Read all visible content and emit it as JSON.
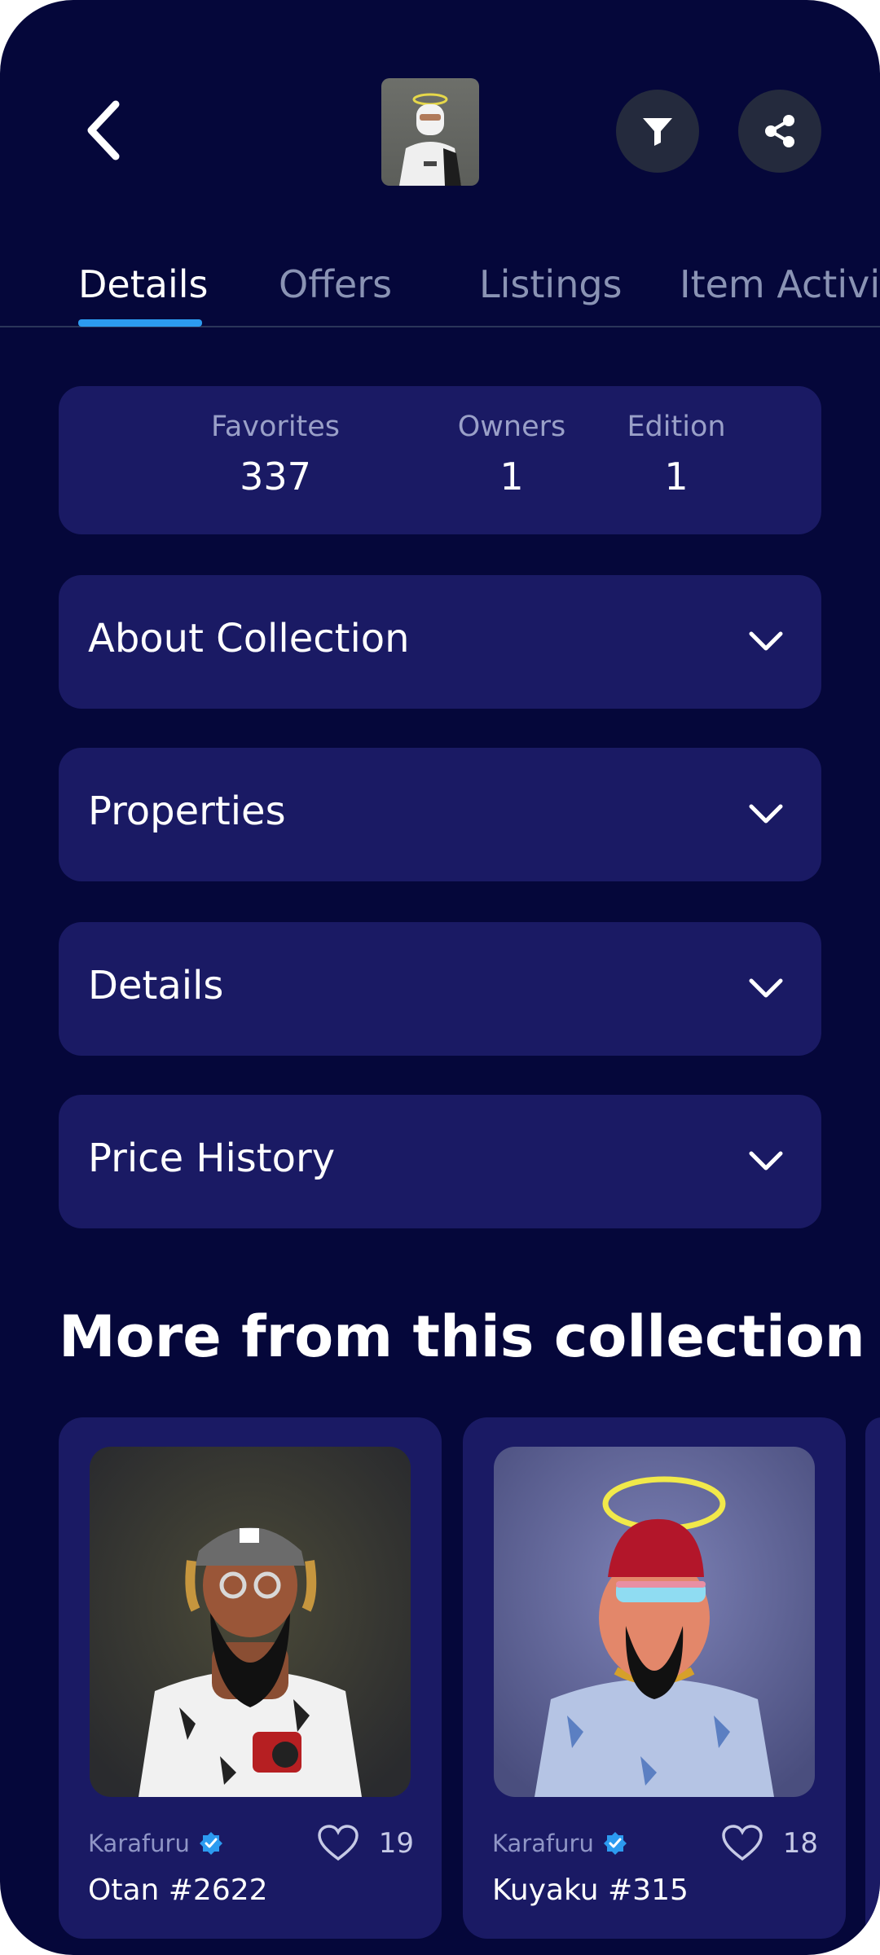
{
  "header": {
    "back_icon": "chevron-left-icon",
    "filter_icon": "filter-icon",
    "share_icon": "share-icon"
  },
  "tabs": [
    {
      "label": "Details",
      "active": true
    },
    {
      "label": "Offers",
      "active": false
    },
    {
      "label": "Listings",
      "active": false
    },
    {
      "label": "Item Activity",
      "active": false
    }
  ],
  "stats": [
    {
      "label": "Favorites",
      "value": "337"
    },
    {
      "label": "Owners",
      "value": "1"
    },
    {
      "label": "Edition",
      "value": "1"
    }
  ],
  "accordions": [
    {
      "title": "About Collection"
    },
    {
      "title": "Properties"
    },
    {
      "title": "Details"
    },
    {
      "title": "Price History"
    }
  ],
  "more_section": {
    "title": "More from this collection"
  },
  "cards": [
    {
      "collection": "Karafuru",
      "verified": true,
      "likes": "19",
      "name": "Otan #2622"
    },
    {
      "collection": "Karafuru",
      "verified": true,
      "likes": "18",
      "name": "Kuyaku #315"
    }
  ],
  "colors": {
    "background": "#05073a",
    "card": "#1a1a64",
    "accent": "#2c9bf0",
    "muted_text": "#8a93b4"
  }
}
